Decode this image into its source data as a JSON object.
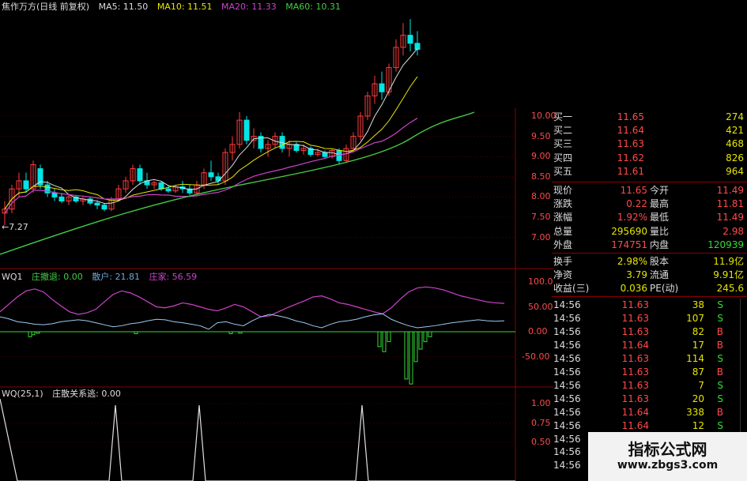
{
  "main_legend": {
    "title": "焦作万方(日线 前复权)",
    "ma5": "MA5: 11.50",
    "ma10": "MA10: 11.51",
    "ma20": "MA20: 11.33",
    "ma60": "MA60: 10.31"
  },
  "low_marker": "←7.27",
  "wq1_legend": {
    "name": "WQ1",
    "l1": "庄撤退: 0.00",
    "l2": "散户: 21.81",
    "l3": "庄家: 56.59"
  },
  "wq2_legend": {
    "name": "WQ(25,1)",
    "l1": "庄散关系逃: 0.00"
  },
  "price_ticks": [
    "10.00",
    "9.50",
    "9.00",
    "8.50",
    "8.00",
    "7.50",
    "7.00"
  ],
  "wq1_ticks": [
    "100.0",
    "50.00",
    "0.00",
    "-50.00"
  ],
  "wq2_ticks": [
    "1.00",
    "0.75",
    "0.50"
  ],
  "colors": {
    "up": "#ff3b3b",
    "down": "#00e5e5",
    "label_up": "#ff4a4a",
    "green": "#33dd33",
    "grid": "#8a0000",
    "magenta": "#cc44cc",
    "yellow": "#e6e600",
    "ma60": "#44cc44"
  },
  "order_book": [
    {
      "label": "买一",
      "price": "11.65",
      "vol": "274"
    },
    {
      "label": "买二",
      "price": "11.64",
      "vol": "421"
    },
    {
      "label": "买三",
      "price": "11.63",
      "vol": "468"
    },
    {
      "label": "买四",
      "price": "11.62",
      "vol": "826"
    },
    {
      "label": "买五",
      "price": "11.61",
      "vol": "964"
    }
  ],
  "stats": [
    {
      "l1": "现价",
      "v1": "11.65",
      "l2": "今开",
      "v2": "11.49"
    },
    {
      "l1": "涨跌",
      "v1": "0.22",
      "l2": "最高",
      "v2": "11.81"
    },
    {
      "l1": "涨幅",
      "v1": "1.92%",
      "l2": "最低",
      "v2": "11.49"
    },
    {
      "l1": "总量",
      "v1": "295690",
      "l2": "量比",
      "v2": "2.98"
    },
    {
      "l1": "外盘",
      "v1": "174751",
      "l2": "内盘",
      "v2": "120939"
    }
  ],
  "stats2": [
    {
      "l1": "换手",
      "v1": "2.98%",
      "l2": "股本",
      "v2": "11.9亿"
    },
    {
      "l1": "净资",
      "v1": "3.79",
      "l2": "流通",
      "v2": "9.91亿"
    },
    {
      "l1": "收益(三)",
      "v1": "0.036",
      "l2": "PE(动)",
      "v2": "245.6"
    }
  ],
  "ticks": [
    {
      "time": "14:56",
      "price": "11.63",
      "vol": "38",
      "side": "S"
    },
    {
      "time": "14:56",
      "price": "11.63",
      "vol": "107",
      "side": "S"
    },
    {
      "time": "14:56",
      "price": "11.63",
      "vol": "82",
      "side": "B"
    },
    {
      "time": "14:56",
      "price": "11.64",
      "vol": "17",
      "side": "B"
    },
    {
      "time": "14:56",
      "price": "11.63",
      "vol": "114",
      "side": "S"
    },
    {
      "time": "14:56",
      "price": "11.63",
      "vol": "87",
      "side": "B"
    },
    {
      "time": "14:56",
      "price": "11.63",
      "vol": "7",
      "side": "S"
    },
    {
      "time": "14:56",
      "price": "11.63",
      "vol": "20",
      "side": "S"
    },
    {
      "time": "14:56",
      "price": "11.64",
      "vol": "338",
      "side": "B"
    },
    {
      "time": "14:56",
      "price": "11.64",
      "vol": "12",
      "side": "S"
    },
    {
      "time": "14:56",
      "price": "",
      "vol": "",
      "side": ""
    },
    {
      "time": "14:56",
      "price": "",
      "vol": "",
      "side": ""
    },
    {
      "time": "14:56",
      "price": "",
      "vol": "",
      "side": ""
    }
  ],
  "watermark": {
    "title": "指标公式网",
    "url": "www.zbgs3.com"
  },
  "chart_data": {
    "type": "candlestick",
    "ylim": [
      7.0,
      10.0
    ],
    "candles": [
      [
        7.6,
        7.9,
        7.3,
        7.7
      ],
      [
        7.7,
        8.3,
        7.6,
        8.2
      ],
      [
        8.2,
        8.6,
        8.0,
        8.4
      ],
      [
        8.4,
        8.6,
        8.1,
        8.2
      ],
      [
        8.2,
        8.9,
        8.1,
        8.8
      ],
      [
        8.7,
        8.8,
        8.2,
        8.3
      ],
      [
        8.3,
        8.4,
        8.0,
        8.1
      ],
      [
        8.1,
        8.2,
        7.9,
        8.0
      ],
      [
        8.0,
        8.1,
        7.85,
        7.9
      ],
      [
        7.9,
        8.05,
        7.8,
        8.0
      ],
      [
        8.0,
        8.05,
        7.85,
        7.9
      ],
      [
        7.9,
        8.0,
        7.8,
        7.95
      ],
      [
        7.95,
        8.0,
        7.8,
        7.85
      ],
      [
        7.85,
        7.9,
        7.7,
        7.8
      ],
      [
        7.8,
        7.85,
        7.65,
        7.7
      ],
      [
        7.7,
        8.0,
        7.65,
        7.95
      ],
      [
        7.95,
        8.3,
        7.9,
        8.2
      ],
      [
        8.2,
        8.5,
        8.1,
        8.4
      ],
      [
        8.4,
        8.8,
        8.3,
        8.7
      ],
      [
        8.7,
        8.8,
        8.3,
        8.4
      ],
      [
        8.4,
        8.6,
        8.2,
        8.3
      ],
      [
        8.3,
        8.4,
        8.2,
        8.35
      ],
      [
        8.35,
        8.4,
        8.15,
        8.2
      ],
      [
        8.2,
        8.3,
        8.1,
        8.15
      ],
      [
        8.15,
        8.3,
        8.1,
        8.25
      ],
      [
        8.25,
        8.4,
        8.1,
        8.2
      ],
      [
        8.2,
        8.3,
        8.05,
        8.1
      ],
      [
        8.1,
        8.4,
        8.05,
        8.3
      ],
      [
        8.3,
        8.7,
        8.2,
        8.6
      ],
      [
        8.6,
        8.9,
        8.4,
        8.5
      ],
      [
        8.5,
        8.6,
        8.3,
        8.4
      ],
      [
        8.4,
        9.2,
        8.3,
        9.1
      ],
      [
        9.1,
        9.5,
        8.9,
        9.3
      ],
      [
        9.3,
        10.1,
        9.2,
        9.9
      ],
      [
        9.9,
        10.0,
        9.3,
        9.4
      ],
      [
        9.4,
        9.7,
        9.2,
        9.5
      ],
      [
        9.5,
        9.6,
        9.1,
        9.2
      ],
      [
        9.2,
        9.4,
        9.0,
        9.3
      ],
      [
        9.3,
        9.6,
        9.2,
        9.5
      ],
      [
        9.5,
        9.6,
        9.1,
        9.2
      ],
      [
        9.2,
        9.4,
        9.0,
        9.3
      ],
      [
        9.3,
        9.35,
        9.1,
        9.15
      ],
      [
        9.15,
        9.3,
        9.05,
        9.2
      ],
      [
        9.2,
        9.25,
        9.0,
        9.05
      ],
      [
        9.05,
        9.2,
        9.0,
        9.1
      ],
      [
        9.1,
        9.15,
        8.95,
        9.0
      ],
      [
        9.0,
        9.2,
        8.95,
        9.15
      ],
      [
        9.15,
        9.2,
        8.8,
        8.9
      ],
      [
        8.9,
        9.3,
        8.85,
        9.2
      ],
      [
        9.2,
        9.6,
        9.1,
        9.5
      ],
      [
        9.5,
        10.1,
        9.4,
        10.0
      ],
      [
        10.0,
        10.6,
        9.9,
        10.5
      ],
      [
        10.5,
        11.0,
        10.3,
        10.8
      ],
      [
        10.8,
        11.1,
        10.4,
        10.6
      ],
      [
        10.6,
        11.3,
        10.5,
        11.2
      ],
      [
        11.2,
        11.9,
        11.1,
        11.7
      ],
      [
        11.7,
        12.3,
        11.5,
        12.0
      ],
      [
        12.0,
        12.4,
        11.6,
        11.8
      ],
      [
        11.8,
        12.1,
        11.5,
        11.65
      ]
    ]
  }
}
